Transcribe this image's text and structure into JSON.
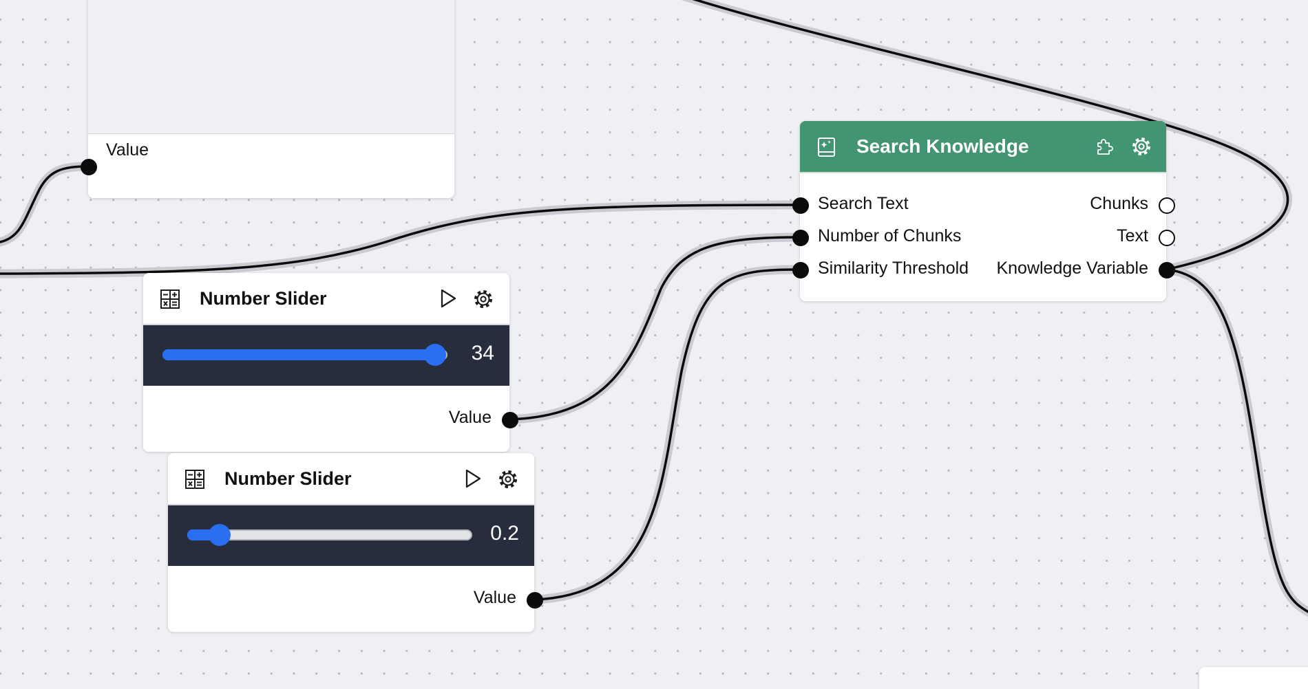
{
  "canvas": {
    "background": "#eff0f4",
    "dot_color": "#b3b6bf"
  },
  "colors": {
    "wire": "#0b0b0c",
    "slider_accent": "#2a6ef2",
    "slider_panel": "#272d3d",
    "search_header": "#439571"
  },
  "top_node": {
    "output_label": "Value"
  },
  "slider_nodes": [
    {
      "title": "Number Slider",
      "icon": "calculator-icon",
      "value": "34",
      "fill_fraction": 1.0,
      "output_label": "Value"
    },
    {
      "title": "Number Slider",
      "icon": "calculator-icon",
      "value": "0.2",
      "fill_fraction": 0.11,
      "output_label": "Value"
    }
  ],
  "search_node": {
    "title": "Search Knowledge",
    "icon": "knowledge-book-icon",
    "inputs": [
      "Search Text",
      "Number of Chunks",
      "Similarity Threshold"
    ],
    "outputs": [
      "Chunks",
      "Text",
      "Knowledge Variable"
    ]
  }
}
